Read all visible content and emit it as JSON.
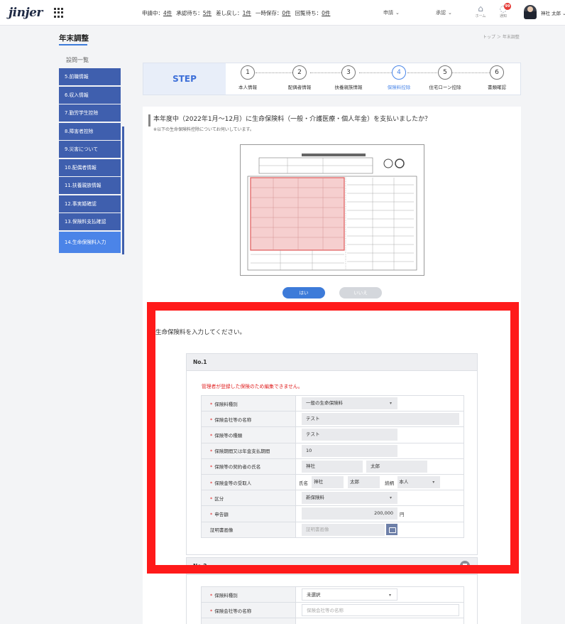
{
  "header": {
    "logo": "jinjer",
    "status": [
      {
        "label": "申請中：",
        "count": "4件"
      },
      {
        "label": "承認待ち：",
        "count": "5件"
      },
      {
        "label": "差し戻し：",
        "count": "1件"
      },
      {
        "label": "一時保存：",
        "count": "0件"
      },
      {
        "label": "回覧待ち：",
        "count": "0件"
      }
    ],
    "apply_menu": "申請",
    "approve_menu": "承認",
    "home_label": "ホーム",
    "notice_label": "通知",
    "notice_count": "99",
    "user_name": "神社 太郎"
  },
  "page": {
    "title": "年末調整",
    "breadcrumb": "トップ ＞ 年末調整"
  },
  "sidebar": {
    "heading": "設問一覧",
    "items": [
      {
        "label": "5.前職情報"
      },
      {
        "label": "6.収入情報"
      },
      {
        "label": "7.勤労学生控除"
      },
      {
        "label": "8.障害者控除"
      },
      {
        "label": "9.災害について"
      },
      {
        "label": "10.配偶者情報"
      },
      {
        "label": "11.扶養親族情報"
      },
      {
        "label": "12.事実婚確認"
      },
      {
        "label": "13.保険料支払確認"
      },
      {
        "label": "14.生命保険料入力"
      }
    ]
  },
  "steps": {
    "title": "STEP",
    "items": [
      {
        "num": "1",
        "label": "本人情報"
      },
      {
        "num": "2",
        "label": "配偶者情報"
      },
      {
        "num": "3",
        "label": "扶養親族情報"
      },
      {
        "num": "4",
        "label": "保険料控除"
      },
      {
        "num": "5",
        "label": "住宅ローン控除"
      },
      {
        "num": "6",
        "label": "書類確認"
      }
    ],
    "active_index": 3
  },
  "question": {
    "text": "本年度中（2022年1月〜12月）に生命保険料（一般・介護医療・個人年金）を支払いましたか？",
    "sub": "※以下の生命保険料控除についてお伺いしています。",
    "yes": "はい",
    "no": "いいえ"
  },
  "insurance": {
    "prompt": "生命保険料を入力してください。",
    "entry1": {
      "title": "No.1",
      "warning": "管理者が登録した保険のため編集できません。",
      "rows": {
        "type_label": "保険料種別",
        "type_value": "一般の生命保険料",
        "company_label": "保険会社等の名称",
        "company_value": "テスト",
        "kind_label": "保険等の種類",
        "kind_value": "テスト",
        "period_label": "保険期間又は年金支払期間",
        "period_value": "10",
        "holder_label": "保険等の契約者の氏名",
        "holder_last": "神社",
        "holder_first": "太郎",
        "recipient_label": "保険金等の受取人",
        "recipient_name_label": "氏名",
        "recipient_last": "神社",
        "recipient_first": "太郎",
        "relation_label": "続柄",
        "relation_value": "本人",
        "category_label": "区分",
        "category_value": "新保険料",
        "amount_label": "申告額",
        "amount_value": "200,000",
        "amount_unit": "円",
        "cert_label": "証明書画像",
        "cert_placeholder": "証明書画像"
      }
    },
    "entry2": {
      "title": "No.2",
      "rows": {
        "type_label": "保険料種別",
        "type_value": "未選択",
        "company_label": "保険会社等の名称",
        "company_placeholder": "保険会社等の名称"
      }
    }
  },
  "colors": {
    "accent": "#3d7bd9",
    "sidebar": "#3f5fae",
    "sidebar_active": "#4b84e8",
    "highlight": "#ff1a1a",
    "warning": "#e02020"
  }
}
